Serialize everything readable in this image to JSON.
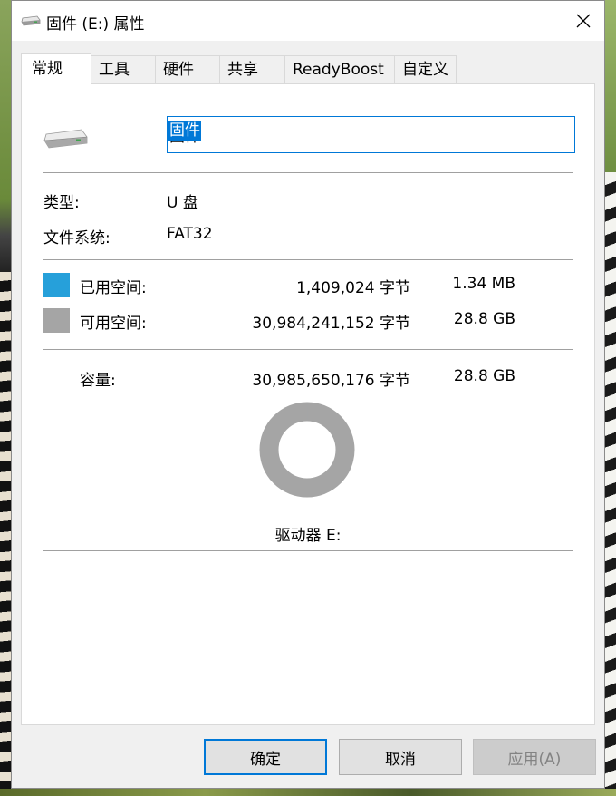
{
  "window": {
    "title": "固件 (E:) 属性",
    "close_glyph": "✕"
  },
  "tabs": [
    {
      "label": "常规",
      "active": true
    },
    {
      "label": "工具",
      "active": false
    },
    {
      "label": "硬件",
      "active": false
    },
    {
      "label": "共享",
      "active": false
    },
    {
      "label": "ReadyBoost",
      "active": false
    },
    {
      "label": "自定义",
      "active": false
    }
  ],
  "general": {
    "drive_name": "固件",
    "type_label": "类型:",
    "type_value": "U 盘",
    "fs_label": "文件系统:",
    "fs_value": "FAT32",
    "used": {
      "label": "已用空间:",
      "bytes": "1,409,024 字节",
      "human": "1.34 MB",
      "color": "#26a0da"
    },
    "free": {
      "label": "可用空间:",
      "bytes": "30,984,241,152 字节",
      "human": "28.8 GB",
      "color": "#a5a5a5"
    },
    "capacity": {
      "label": "容量:",
      "bytes": "30,985,650,176 字节",
      "human": "28.8 GB"
    },
    "used_fraction": 4.55e-05,
    "drive_caption": "驱动器 E:"
  },
  "buttons": {
    "ok": "确定",
    "cancel": "取消",
    "apply": "应用(A)"
  },
  "icons": {
    "title": "drive-icon",
    "large": "drive-icon",
    "close": "close-icon"
  }
}
